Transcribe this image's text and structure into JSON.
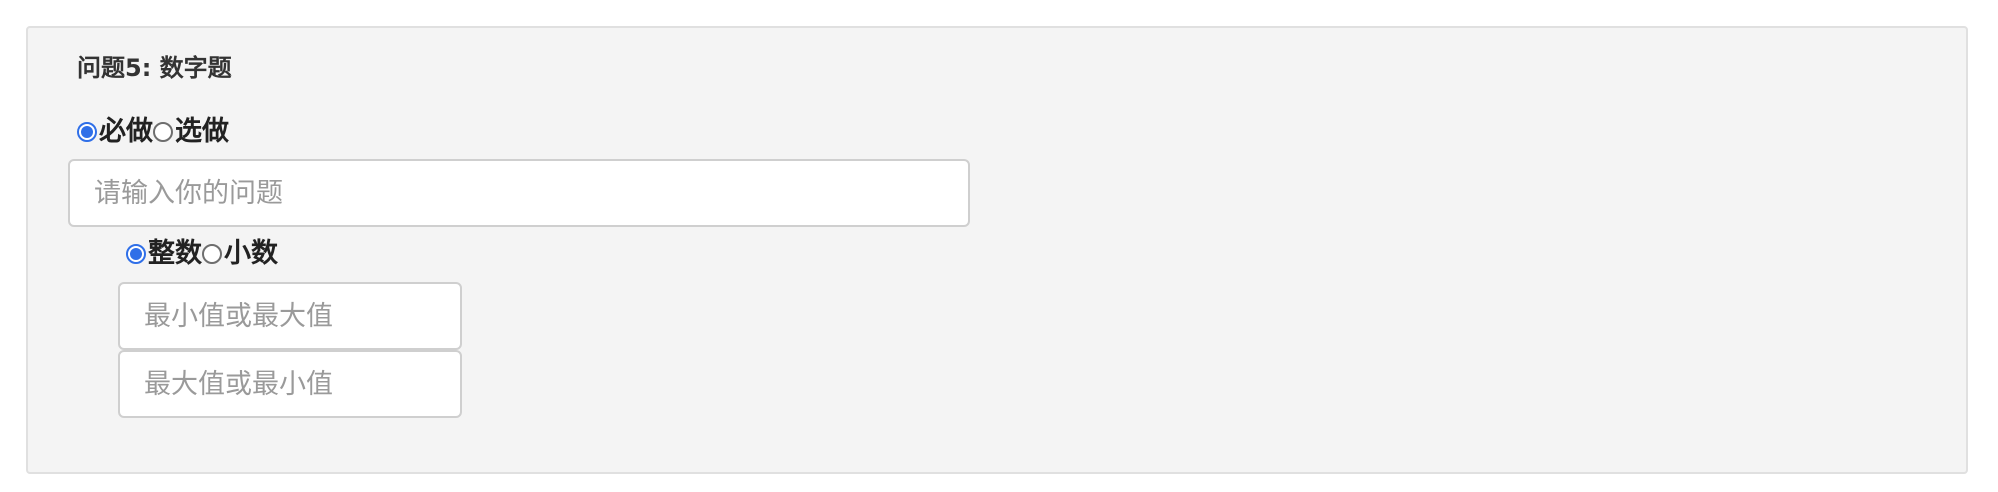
{
  "question": {
    "title": "问题5: 数字题",
    "requirement": {
      "options": [
        {
          "label": "必做",
          "selected": true
        },
        {
          "label": "选做",
          "selected": false
        }
      ]
    },
    "question_input": {
      "value": "",
      "placeholder": "请输入你的问题"
    },
    "number_type": {
      "options": [
        {
          "label": "整数",
          "selected": true
        },
        {
          "label": "小数",
          "selected": false
        }
      ]
    },
    "range": {
      "first": {
        "value": "",
        "placeholder": "最小值或最大值"
      },
      "second": {
        "value": "",
        "placeholder": "最大值或最小值"
      }
    }
  },
  "colors": {
    "panel_background": "#f4f4f4",
    "radio_checked": "#2f6fe8",
    "input_border": "#cfcfcf",
    "placeholder": "#9a9a9a"
  }
}
